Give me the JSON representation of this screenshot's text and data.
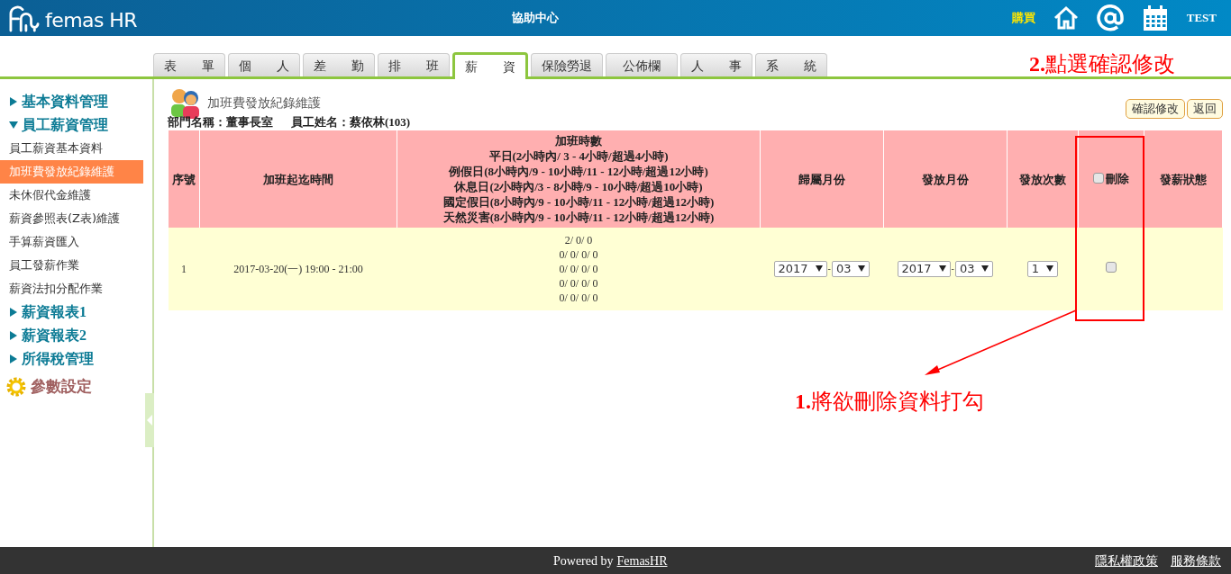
{
  "header": {
    "logo_text": "femas HR",
    "center_link": "協助中心",
    "buy_link": "購買",
    "user": "TEST"
  },
  "tabs": [
    {
      "label": "表　　單",
      "selected": false
    },
    {
      "label": "個　　人",
      "selected": false
    },
    {
      "label": "差　　勤",
      "selected": false
    },
    {
      "label": "排　　班",
      "selected": false
    },
    {
      "label": "薪　　資",
      "selected": true
    },
    {
      "label": "保險勞退",
      "selected": false
    },
    {
      "label": "公佈欄",
      "selected": false
    },
    {
      "label": "人　　事",
      "selected": false
    },
    {
      "label": "系　　統",
      "selected": false
    }
  ],
  "sidebar": {
    "items": [
      {
        "kind": "section",
        "label": "基本資料管理",
        "expanded": false
      },
      {
        "kind": "section",
        "label": "員工薪資管理",
        "expanded": true,
        "children": [
          {
            "label": "員工薪資基本資料",
            "selected": false
          },
          {
            "label": "加班費發放紀錄維護",
            "selected": true
          },
          {
            "label": "未休假代金維護",
            "selected": false
          },
          {
            "label": "薪資參照表(Z表)維護",
            "selected": false
          },
          {
            "label": "手算薪資匯入",
            "selected": false
          },
          {
            "label": "員工發薪作業",
            "selected": false
          },
          {
            "label": "薪資法扣分配作業",
            "selected": false
          }
        ]
      },
      {
        "kind": "section",
        "label": "薪資報表1",
        "expanded": false
      },
      {
        "kind": "section",
        "label": "薪資報表2",
        "expanded": false
      },
      {
        "kind": "section",
        "label": "所得稅管理",
        "expanded": false
      },
      {
        "kind": "settings",
        "label": "參數設定"
      }
    ]
  },
  "page": {
    "title": "加班費發放紀錄維護",
    "department": "部門名稱：董事長室",
    "employee": "員工姓名：蔡依林(103)",
    "buttons": [
      "確認修改",
      "返回"
    ]
  },
  "table": {
    "columns": [
      {
        "kind": "text",
        "label": "序號"
      },
      {
        "kind": "text",
        "label": "加班起迄時間"
      },
      {
        "kind": "multiline",
        "label": "加班時數",
        "lines": [
          "平日(2小時內/ 3 - 4小時/超過4小時)",
          "例假日(8小時內/9 - 10小時/11 - 12小時/超過12小時)",
          "休息日(2小時內/3 - 8小時/9 - 10小時/超過10小時)",
          "國定假日(8小時內/9 - 10小時/11 - 12小時/超過12小時)",
          "天然災害(8小時內/9 - 10小時/11 - 12小時/超過12小時)"
        ]
      },
      {
        "kind": "text",
        "label": "歸屬月份"
      },
      {
        "kind": "text",
        "label": "發放月份"
      },
      {
        "kind": "text",
        "label": "發放次數"
      },
      {
        "kind": "checkbox",
        "label": "刪除",
        "checked": false
      },
      {
        "kind": "text",
        "label": "發薪狀態"
      }
    ],
    "rows": [
      {
        "seq": "1",
        "time": "2017-03-20(一) 19:00 - 21:00",
        "hours": [
          "2/ 0/ 0",
          "0/ 0/ 0/ 0",
          "0/ 0/ 0/ 0",
          "0/ 0/ 0/ 0",
          "0/ 0/ 0/ 0"
        ],
        "belong_year": "2017",
        "belong_separator": "-",
        "belong_month": "03",
        "pay_year": "2017",
        "pay_separator": "-",
        "pay_month": "03",
        "count": "1",
        "delete_checked": false
      }
    ]
  },
  "annotations": [
    {
      "text": "**2.**點選確認修改"
    },
    {
      "text": "**1.**將欲刪除資料打勾"
    }
  ],
  "footer": {
    "powered": "Powered by",
    "brand_link": "FemasHR",
    "links": [
      "隱私權政策",
      "服務條款"
    ]
  }
}
